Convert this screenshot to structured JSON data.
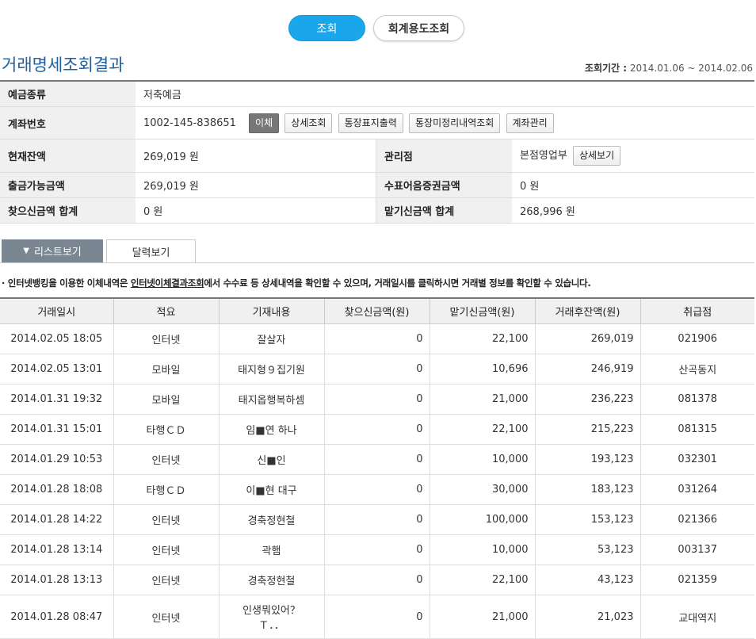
{
  "buttons": {
    "search": "조회",
    "account_purpose": "회계용도조회"
  },
  "title": "거래명세조회결과",
  "period": {
    "label": "조회기간 :",
    "value": "2014.01.06 ~ 2014.02.06"
  },
  "info": {
    "deposit_type_label": "예금종류",
    "deposit_type": "저축예금",
    "account_label": "계좌번호",
    "account_no": "1002-145-838651",
    "account_buttons": [
      "이체",
      "상세조회",
      "통장표지출력",
      "통장미정리내역조회",
      "계좌관리"
    ],
    "balance_label": "현재잔액",
    "balance": "269,019 원",
    "branch_label": "관리점",
    "branch": "본점영업부",
    "branch_detail_btn": "상세보기",
    "withdrawable_label": "출금가능금액",
    "withdrawable": "269,019 원",
    "check_label": "수표어음증권금액",
    "check": "0 원",
    "withdraw_total_label": "찾으신금액 합계",
    "withdraw_total": "0 원",
    "deposit_total_label": "맡기신금액 합계",
    "deposit_total": "268,996 원"
  },
  "tabs": {
    "list": "리스트보기",
    "calendar": "달력보기"
  },
  "notice": {
    "pre": "인터넷뱅킹을 이용한 이체내역은 ",
    "link": "인터넷이체결과조회",
    "post": "에서 수수료 등 상세내역을 확인할 수 있으며, 거래일시를 클릭하시면 거래별 정보를 확인할 수 있습니다."
  },
  "table": {
    "headers": [
      "거래일시",
      "적요",
      "기재내용",
      "찾으신금액(원)",
      "맡기신금액(원)",
      "거래후잔액(원)",
      "취급점"
    ],
    "rows": [
      [
        "2014.02.05 18:05",
        "인터넷",
        "잘살자",
        "0",
        "22,100",
        "269,019",
        "021906"
      ],
      [
        "2014.02.05 13:01",
        "모바일",
        "태지형９집기원",
        "0",
        "10,696",
        "246,919",
        "산곡동지"
      ],
      [
        "2014.01.31 19:32",
        "모바일",
        "태지옵행복하셈",
        "0",
        "21,000",
        "236,223",
        "081378"
      ],
      [
        "2014.01.31 15:01",
        "타행ＣＤ",
        "임■연 하나",
        "0",
        "22,100",
        "215,223",
        "081315"
      ],
      [
        "2014.01.29 10:53",
        "인터넷",
        "신■인",
        "0",
        "10,000",
        "193,123",
        "032301"
      ],
      [
        "2014.01.28 18:08",
        "타행ＣＤ",
        "이■현 대구",
        "0",
        "30,000",
        "183,123",
        "031264"
      ],
      [
        "2014.01.28 14:22",
        "인터넷",
        "경축정현철",
        "0",
        "100,000",
        "153,123",
        "021366"
      ],
      [
        "2014.01.28 13:14",
        "인터넷",
        "곽햄",
        "0",
        "10,000",
        "53,123",
        "003137"
      ],
      [
        "2014.01.28 13:13",
        "인터넷",
        "경축정현철",
        "0",
        "22,100",
        "43,123",
        "021359"
      ],
      [
        "2014.01.28 08:47",
        "인터넷",
        "인생뭐있어？ Ｔ．．",
        "0",
        "21,000",
        "21,023",
        "교대역지"
      ]
    ]
  }
}
